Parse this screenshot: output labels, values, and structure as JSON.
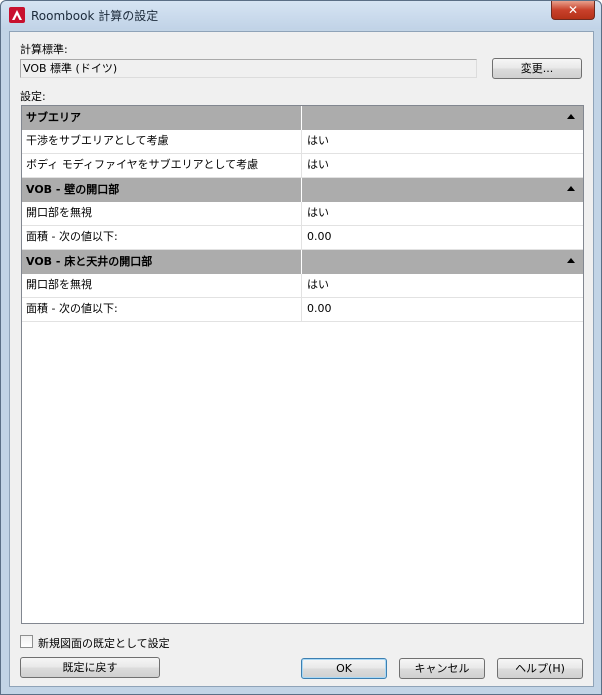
{
  "window": {
    "title": "Roombook 計算の設定",
    "close_label": "✕"
  },
  "standard": {
    "label": "計算標準:",
    "value": "VOB 標準 (ドイツ)",
    "change_button": "変更..."
  },
  "settings": {
    "label": "設定:",
    "groups": [
      {
        "title": "サブエリア",
        "rows": [
          {
            "name": "干渉をサブエリアとして考慮",
            "value": "はい"
          },
          {
            "name": "ボディ モディファイヤをサブエリアとして考慮",
            "value": "はい"
          }
        ]
      },
      {
        "title": "VOB - 壁の開口部",
        "rows": [
          {
            "name": "開口部を無視",
            "value": "はい"
          },
          {
            "name": "面積 - 次の値以下:",
            "value": "0.00"
          }
        ]
      },
      {
        "title": "VOB - 床と天井の開口部",
        "rows": [
          {
            "name": "開口部を無視",
            "value": "はい"
          },
          {
            "name": "面積 - 次の値以下:",
            "value": "0.00"
          }
        ]
      }
    ]
  },
  "footer": {
    "new_default_checkbox_label": "新規図面の既定として設定",
    "new_default_checked": false,
    "reset_button": "既定に戻す",
    "ok_button": "OK",
    "cancel_button": "キャンセル",
    "help_button": "ヘルプ(H)"
  }
}
